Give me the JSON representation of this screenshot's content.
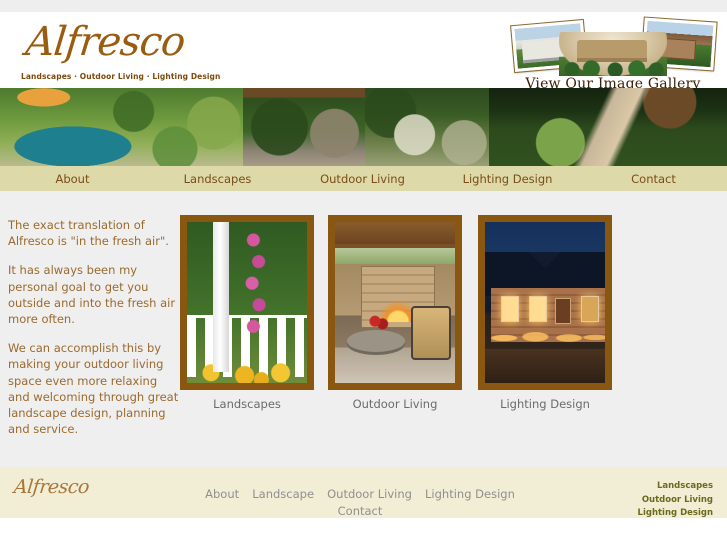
{
  "header": {
    "logo": {
      "name": "Alfresco",
      "tagline": "Landscapes · Outdoor Living · Lighting Design"
    },
    "gallery": {
      "caption": "View Our Image Gallery"
    }
  },
  "nav": {
    "items": [
      {
        "label": "About"
      },
      {
        "label": "Landscapes"
      },
      {
        "label": "Outdoor Living"
      },
      {
        "label": "Lighting Design"
      },
      {
        "label": "Contact"
      }
    ]
  },
  "banner": {
    "images": [
      {
        "alt": "swimming pool with landscaped garden"
      },
      {
        "alt": "stone pergola with hanging plants"
      },
      {
        "alt": "patio garden with stone wall"
      },
      {
        "alt": "lit garden pathway at dusk"
      }
    ]
  },
  "main": {
    "intro": {
      "paragraphs": [
        "The exact translation of Alfresco is \"in the fresh air\".",
        "It has always been my personal goal to get you outside and into the fresh air more often.",
        "We can accomplish this by making your outdoor living space even more relaxing and welcoming through great landscape design, planning and service."
      ]
    },
    "cards": [
      {
        "caption": "Landscapes",
        "alt": "white picket fence with flowering garden"
      },
      {
        "caption": "Outdoor Living",
        "alt": "covered patio with stone fireplace and furniture"
      },
      {
        "caption": "Lighting Design",
        "alt": "house at night with landscape lighting"
      }
    ]
  },
  "footer": {
    "logo": "Alfresco",
    "nav": [
      {
        "label": "About"
      },
      {
        "label": "Landscape"
      },
      {
        "label": "Outdoor Living"
      },
      {
        "label": "Lighting Design"
      },
      {
        "label": "Contact"
      }
    ],
    "links": [
      {
        "label": "Landscapes"
      },
      {
        "label": "Outdoor Living"
      },
      {
        "label": "Lighting Design"
      }
    ]
  },
  "colors": {
    "brand_brown": "#9a5c10",
    "nav_background": "#ddd9a8",
    "nav_text": "#7b4d17",
    "content_background": "#efefef",
    "intro_text": "#9a6a2e",
    "frame_border": "#8a5710",
    "footer_background": "#f2eed6",
    "footer_link": "#6c6a1c"
  }
}
